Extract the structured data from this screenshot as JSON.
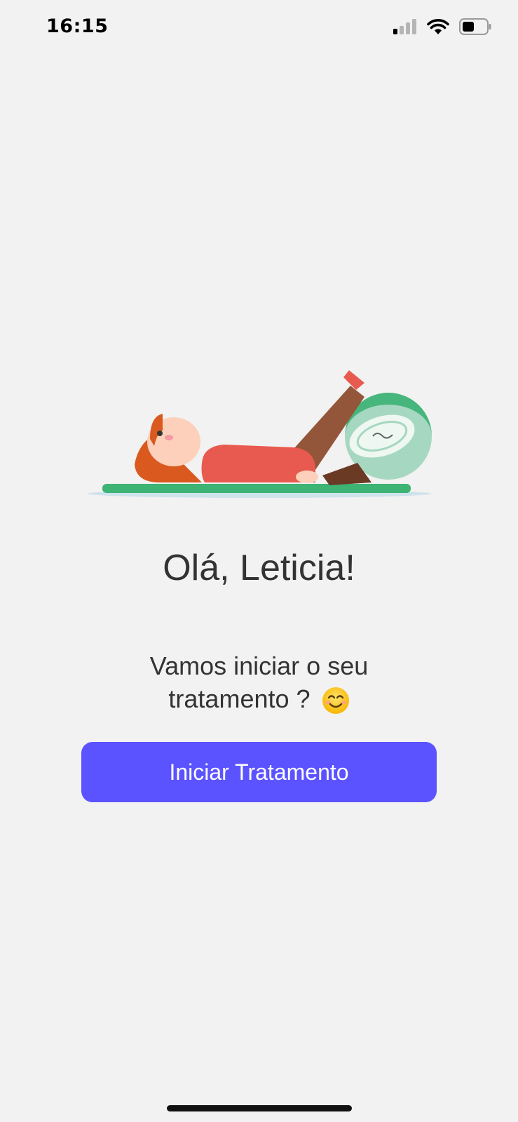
{
  "status_bar": {
    "time": "16:15",
    "icons": [
      "signal-icon",
      "wifi-icon",
      "battery-icon"
    ]
  },
  "illustration": {
    "name": "woman-exercising-with-ball-illustration"
  },
  "main": {
    "greeting": "Olá, Leticia!",
    "subtitle_line1": "Vamos iniciar o seu",
    "subtitle_line2": "tratamento ?",
    "subtitle_emoji": "smiling-face-emoji",
    "start_button_label": "Iniciar Tratamento"
  },
  "colors": {
    "background": "#f2f2f2",
    "primary_button": "#5b53ff",
    "text": "#333333"
  }
}
